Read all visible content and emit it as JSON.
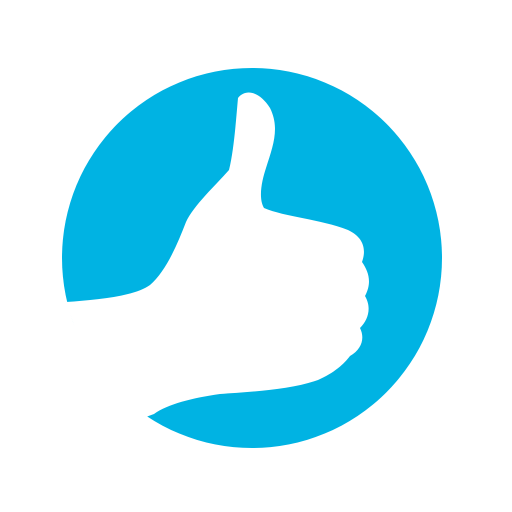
{
  "icon": {
    "name": "thumbs-up-icon",
    "colors": {
      "circle": "#00B3E3",
      "hand": "#FFFFFF",
      "background": "#FFFFFF"
    }
  }
}
